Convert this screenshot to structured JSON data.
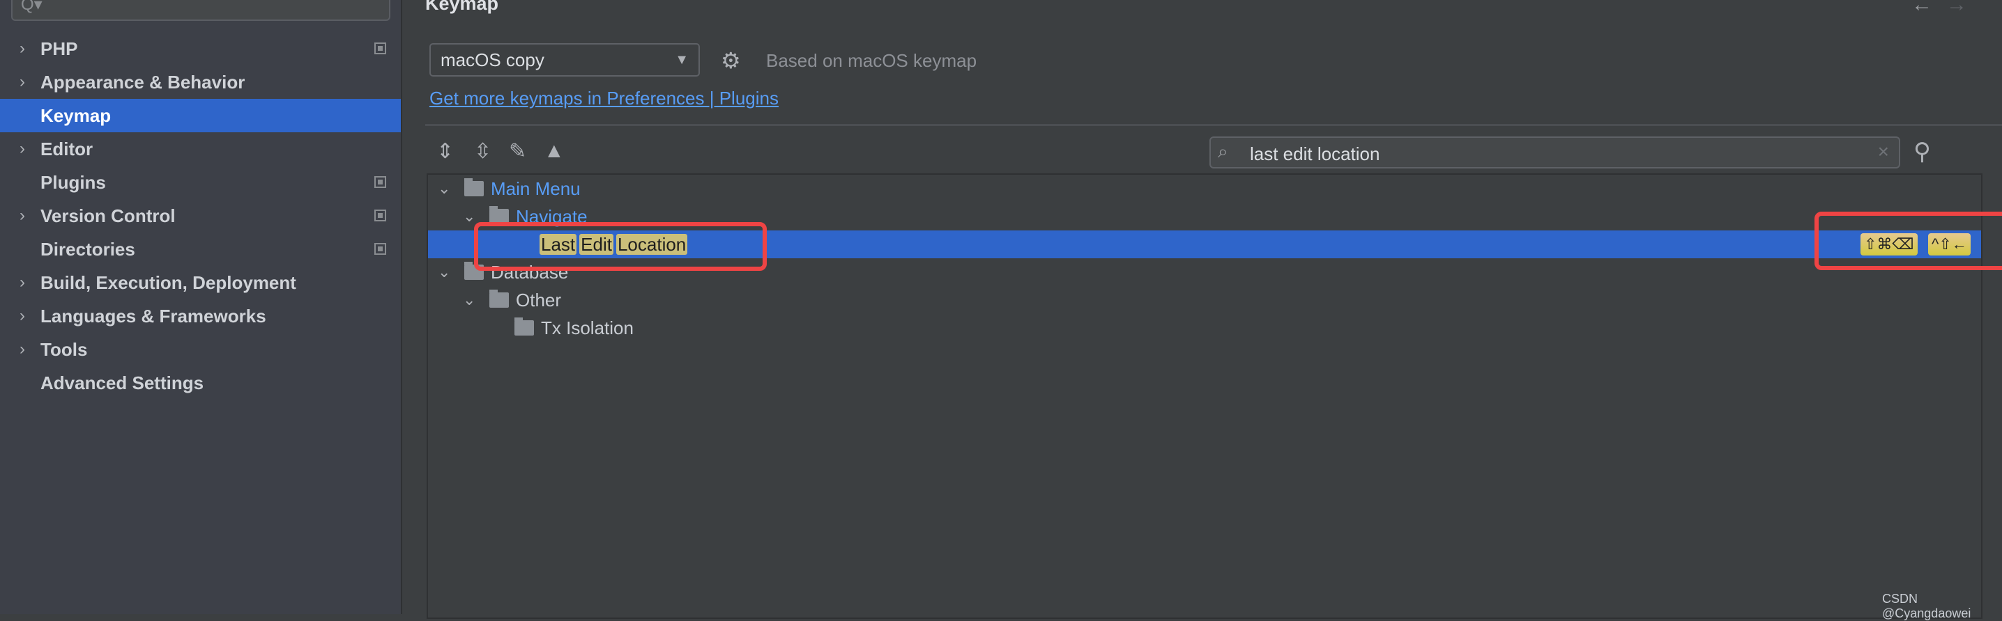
{
  "sidebar": {
    "search_placeholder": "Q▾",
    "items": [
      {
        "label": "PHP",
        "expandable": true,
        "badge": true
      },
      {
        "label": "Appearance & Behavior",
        "expandable": true,
        "badge": false
      },
      {
        "label": "Keymap",
        "expandable": false,
        "badge": false,
        "selected": true
      },
      {
        "label": "Editor",
        "expandable": true,
        "badge": false
      },
      {
        "label": "Plugins",
        "expandable": false,
        "badge": true
      },
      {
        "label": "Version Control",
        "expandable": true,
        "badge": true
      },
      {
        "label": "Directories",
        "expandable": false,
        "badge": true
      },
      {
        "label": "Build, Execution, Deployment",
        "expandable": true,
        "badge": false
      },
      {
        "label": "Languages & Frameworks",
        "expandable": true,
        "badge": false
      },
      {
        "label": "Tools",
        "expandable": true,
        "badge": false
      },
      {
        "label": "Advanced Settings",
        "expandable": false,
        "badge": false
      }
    ]
  },
  "header": {
    "title": "Keymap",
    "back": "←",
    "forward": "→"
  },
  "keymap": {
    "selected": "macOS copy",
    "based_on": "Based on macOS keymap",
    "link": "Get more keymaps in Preferences | Plugins"
  },
  "toolbar": {
    "icons": [
      "expand-all-icon",
      "collapse-all-icon",
      "edit-icon",
      "warning-icon"
    ]
  },
  "search": {
    "value": "last edit location",
    "clear": "×"
  },
  "tree": {
    "main_menu": "Main Menu",
    "navigate": "Navigate",
    "action": [
      "Last",
      "Edit",
      "Location"
    ],
    "shortcuts": [
      "⇧⌘⌫",
      "^⇧←"
    ],
    "database": "Database",
    "other": "Other",
    "tx_isolation": "Tx Isolation"
  },
  "colors": {
    "selection": "#2f65ca",
    "highlight": "#cbbf7a",
    "annotation": "#ef4444",
    "link": "#589df6"
  },
  "watermark": "CSDN @Cyangdaowei"
}
